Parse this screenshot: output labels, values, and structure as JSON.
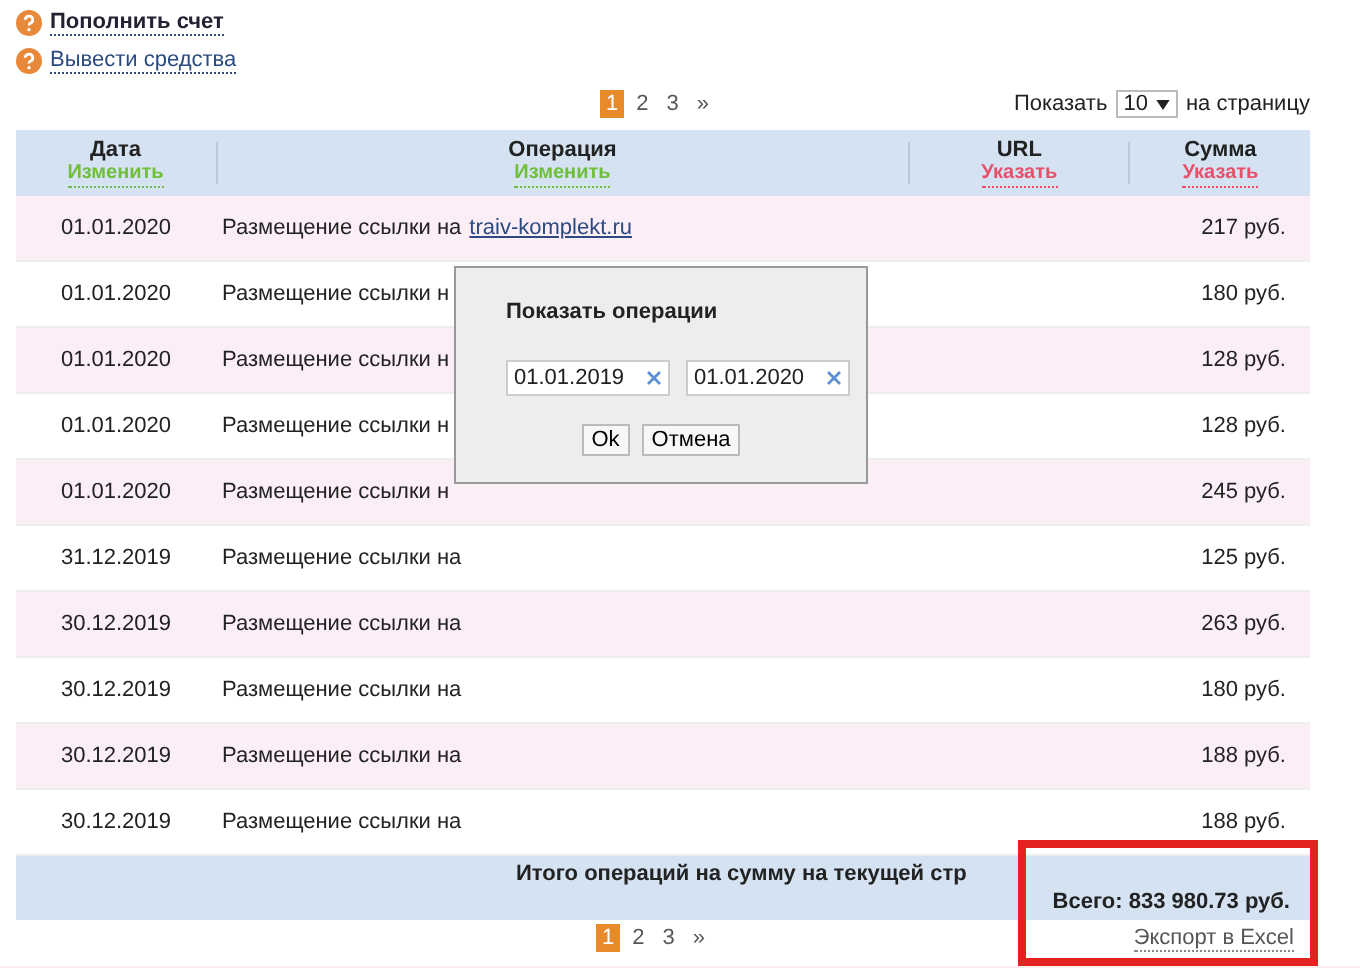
{
  "links": [
    {
      "label": "Пополнить счет",
      "kind": "bold"
    },
    {
      "label": "Вывести средства",
      "kind": "plain"
    }
  ],
  "pager_top": [
    {
      "label": "1",
      "selected": true
    },
    {
      "label": "2",
      "selected": false
    },
    {
      "label": "3",
      "selected": false
    },
    {
      "label": "»",
      "selected": false
    }
  ],
  "per_page": {
    "before": "Показать",
    "value": "10",
    "after": "на страницу"
  },
  "table": {
    "columns": [
      {
        "title": "Дата",
        "action": "Изменить",
        "kind": "change"
      },
      {
        "title": "Операция",
        "action": "Изменить",
        "kind": "change"
      },
      {
        "title": "URL",
        "action": "Указать",
        "kind": "set"
      },
      {
        "title": "Сумма",
        "action": "Указать",
        "kind": "set"
      }
    ],
    "rows": [
      {
        "date": "01.01.2020",
        "operation": "Размещение ссылки на",
        "link": "traiv-komplekt.ru",
        "sum": "217 руб."
      },
      {
        "date": "01.01.2020",
        "operation": "Размещение ссылки н",
        "sum": "180 руб."
      },
      {
        "date": "01.01.2020",
        "operation": "Размещение ссылки н",
        "sum": "128 руб."
      },
      {
        "date": "01.01.2020",
        "operation": "Размещение ссылки н",
        "sum": "128 руб."
      },
      {
        "date": "01.01.2020",
        "operation": "Размещение ссылки н",
        "sum": "245 руб."
      },
      {
        "date": "31.12.2019",
        "operation": "Размещение ссылки на",
        "sum": "125 руб."
      },
      {
        "date": "30.12.2019",
        "operation": "Размещение ссылки на",
        "sum": "263 руб."
      },
      {
        "date": "30.12.2019",
        "operation": "Размещение ссылки на",
        "sum": "180 руб."
      },
      {
        "date": "30.12.2019",
        "operation": "Размещение ссылки на",
        "sum": "188 руб."
      },
      {
        "date": "30.12.2019",
        "operation": "Размещение ссылки на",
        "sum": "188 руб."
      }
    ],
    "total_label": "Итого операций на сумму на текущей стр",
    "grand_total": "Всего:  833 980.73 руб."
  },
  "pager_bottom": [
    {
      "label": "1",
      "selected": true
    },
    {
      "label": "2",
      "selected": false
    },
    {
      "label": "3",
      "selected": false
    },
    {
      "label": "»",
      "selected": false
    }
  ],
  "export_link": "Экспорт в Excel",
  "dialog": {
    "title": "Показать операции",
    "date_from": "01.01.2019",
    "date_to": "01.01.2020",
    "buttons": [
      "Ok",
      "Отмена"
    ]
  }
}
